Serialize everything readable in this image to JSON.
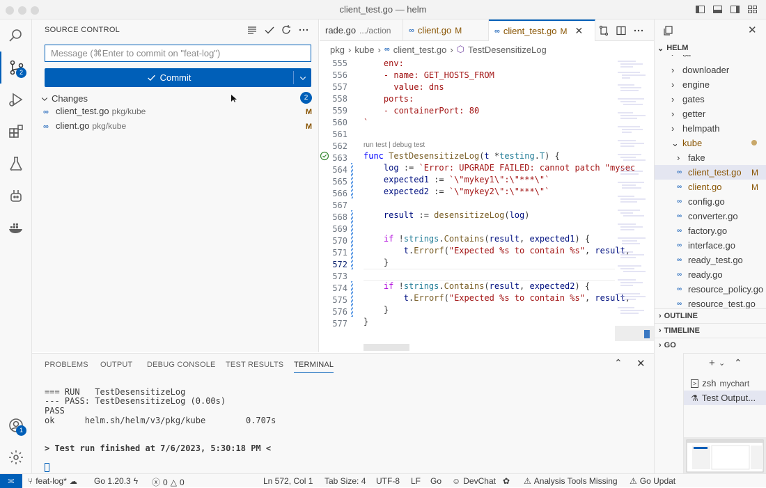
{
  "window": {
    "title": "client_test.go — helm"
  },
  "activity": {
    "scm_badge": "2",
    "accounts_badge": "1"
  },
  "sidebar": {
    "title": "SOURCE CONTROL",
    "message_placeholder": "Message (⌘Enter to commit on \"feat-log\")",
    "commit_label": "Commit",
    "changes_label": "Changes",
    "changes_count": "2",
    "files": [
      {
        "name": "client_test.go",
        "dir": "pkg/kube",
        "status": "M"
      },
      {
        "name": "client.go",
        "dir": "pkg/kube",
        "status": "M"
      }
    ]
  },
  "tabs": [
    {
      "label": "rade.go",
      "detail": ".../action"
    },
    {
      "label": "client.go",
      "status": "M"
    },
    {
      "label": "client_test.go",
      "status": "M"
    }
  ],
  "breadcrumb": [
    "pkg",
    "kube",
    "client_test.go",
    "TestDesensitizeLog"
  ],
  "editor": {
    "codelens": "run test | debug test",
    "line_numbers": [
      "555",
      "556",
      "557",
      "558",
      "559",
      "560",
      "561",
      "562",
      "563",
      "564",
      "565",
      "566",
      "567",
      "568",
      "569",
      "570",
      "571",
      "572",
      "573",
      "574",
      "575",
      "576",
      "577"
    ]
  },
  "explorer": {
    "root": "HELM",
    "items": [
      {
        "label": "cli",
        "kind": "folder"
      },
      {
        "label": "downloader",
        "kind": "folder"
      },
      {
        "label": "engine",
        "kind": "folder"
      },
      {
        "label": "gates",
        "kind": "folder"
      },
      {
        "label": "getter",
        "kind": "folder"
      },
      {
        "label": "helmpath",
        "kind": "folder"
      },
      {
        "label": "kube",
        "kind": "open-folder"
      },
      {
        "label": "fake",
        "kind": "folder"
      },
      {
        "label": "client_test.go",
        "kind": "file",
        "status": "M"
      },
      {
        "label": "client.go",
        "kind": "file",
        "status": "M"
      },
      {
        "label": "config.go",
        "kind": "file"
      },
      {
        "label": "converter.go",
        "kind": "file"
      },
      {
        "label": "factory.go",
        "kind": "file"
      },
      {
        "label": "interface.go",
        "kind": "file"
      },
      {
        "label": "ready_test.go",
        "kind": "file"
      },
      {
        "label": "ready.go",
        "kind": "file"
      },
      {
        "label": "resource_policy.go",
        "kind": "file"
      },
      {
        "label": "resource_test.go",
        "kind": "file"
      }
    ],
    "sections": [
      "OUTLINE",
      "TIMELINE",
      "GO"
    ]
  },
  "panel": {
    "tabs": [
      "PROBLEMS",
      "OUTPUT",
      "DEBUG CONSOLE",
      "TEST RESULTS",
      "TERMINAL"
    ],
    "terminal_lines": [
      "=== RUN   TestDesensitizeLog",
      "--- PASS: TestDesensitizeLog (0.00s)",
      "PASS",
      "ok      helm.sh/helm/v3/pkg/kube        0.707s",
      "",
      "> Test run finished at 7/6/2023, 5:30:18 PM <"
    ],
    "terminals": [
      {
        "label": "zsh",
        "detail": "mychart"
      },
      {
        "label": "Test Output..."
      }
    ]
  },
  "status": {
    "branch": "feat-log*",
    "go_version": "Go 1.20.3",
    "errors": "0",
    "warnings": "0",
    "position": "Ln 572, Col 1",
    "tab_size": "Tab Size: 4",
    "encoding": "UTF-8",
    "eol": "LF",
    "language": "Go",
    "devchat": "DevChat",
    "analysis": "Analysis Tools Missing",
    "update": "Go Updat"
  },
  "colors": {
    "accent": "#005fb8",
    "modified": "#895503"
  }
}
